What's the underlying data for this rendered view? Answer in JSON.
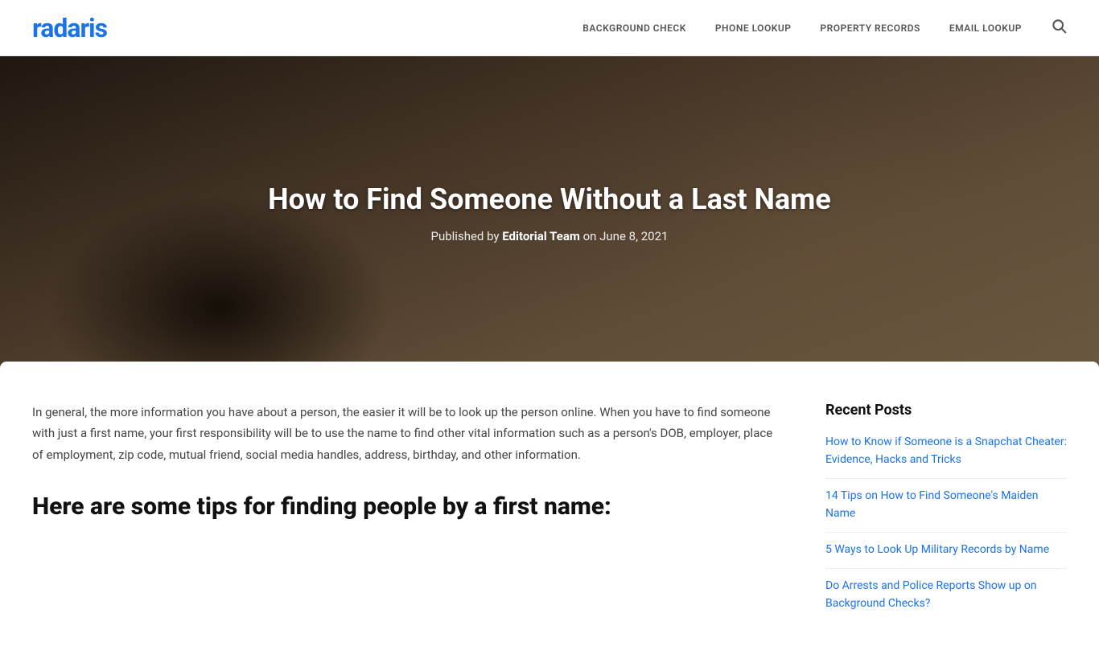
{
  "header": {
    "logo": "radaris",
    "nav": [
      {
        "label": "BACKGROUND CHECK",
        "id": "bg-check"
      },
      {
        "label": "PHONE LOOKUP",
        "id": "phone-lookup"
      },
      {
        "label": "PROPERTY RECORDS",
        "id": "property-records"
      },
      {
        "label": "EMAIL LOOKUP",
        "id": "email-lookup"
      }
    ]
  },
  "hero": {
    "title": "How to Find Someone Without a Last Name",
    "meta_prefix": "Published by ",
    "author": "Editorial Team",
    "meta_suffix": " on June 8, 2021"
  },
  "article": {
    "intro": "In general, the more information you have about a person, the easier it will be to look up the person online. When you have to find someone with just a first name, your first responsibility will be to use the name to find other vital information such as a person's DOB, employer, place of employment, zip code, mutual friend, social media handles, address, birthday, and other information.",
    "subheading": "Here are some tips for finding people by a first name:"
  },
  "sidebar": {
    "section_title": "Recent Posts",
    "posts": [
      {
        "title": "How to Know if Someone is a Snapchat Cheater: Evidence, Hacks and Tricks"
      },
      {
        "title": "14 Tips on How to Find Someone's Maiden Name"
      },
      {
        "title": "5 Ways to Look Up Military Records by Name"
      },
      {
        "title": "Do Arrests and Police Reports Show up on Background Checks?"
      }
    ]
  }
}
